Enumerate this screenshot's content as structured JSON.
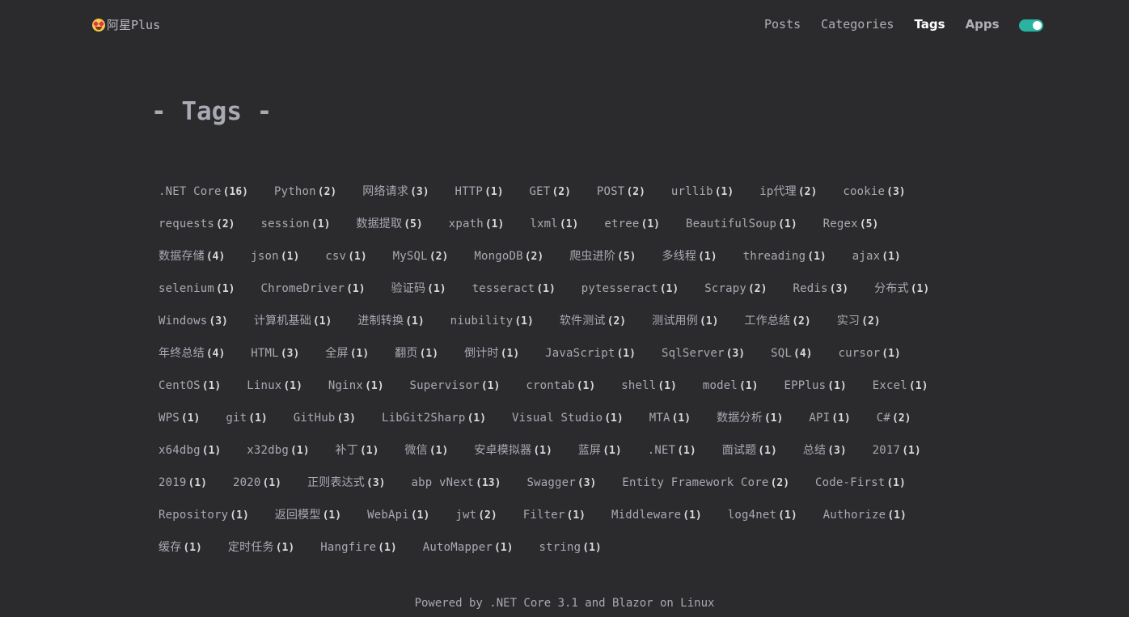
{
  "header": {
    "logo_text": "阿星Plus",
    "nav": [
      {
        "label": "Posts",
        "active": false
      },
      {
        "label": "Categories",
        "active": false
      },
      {
        "label": "Tags",
        "active": true
      },
      {
        "label": "Apps",
        "active": false
      }
    ],
    "theme_toggle_on": true,
    "accent_color": "#2ab3a0"
  },
  "page": {
    "title": "- Tags -"
  },
  "tags": [
    {
      "name": ".NET Core",
      "count": "(16)"
    },
    {
      "name": "Python",
      "count": "(2)"
    },
    {
      "name": "网络请求",
      "count": "(3)"
    },
    {
      "name": "HTTP",
      "count": "(1)"
    },
    {
      "name": "GET",
      "count": "(2)"
    },
    {
      "name": "POST",
      "count": "(2)"
    },
    {
      "name": "urllib",
      "count": "(1)"
    },
    {
      "name": "ip代理",
      "count": "(2)"
    },
    {
      "name": "cookie",
      "count": "(3)"
    },
    {
      "name": "requests",
      "count": "(2)"
    },
    {
      "name": "session",
      "count": "(1)"
    },
    {
      "name": "数据提取",
      "count": "(5)"
    },
    {
      "name": "xpath",
      "count": "(1)"
    },
    {
      "name": "lxml",
      "count": "(1)"
    },
    {
      "name": "etree",
      "count": "(1)"
    },
    {
      "name": "BeautifulSoup",
      "count": "(1)"
    },
    {
      "name": "Regex",
      "count": "(5)"
    },
    {
      "name": "数据存储",
      "count": "(4)"
    },
    {
      "name": "json",
      "count": "(1)"
    },
    {
      "name": "csv",
      "count": "(1)"
    },
    {
      "name": "MySQL",
      "count": "(2)"
    },
    {
      "name": "MongoDB",
      "count": "(2)"
    },
    {
      "name": "爬虫进阶",
      "count": "(5)"
    },
    {
      "name": "多线程",
      "count": "(1)"
    },
    {
      "name": "threading",
      "count": "(1)"
    },
    {
      "name": "ajax",
      "count": "(1)"
    },
    {
      "name": "selenium",
      "count": "(1)"
    },
    {
      "name": "ChromeDriver",
      "count": "(1)"
    },
    {
      "name": "验证码",
      "count": "(1)"
    },
    {
      "name": "tesseract",
      "count": "(1)"
    },
    {
      "name": "pytesseract",
      "count": "(1)"
    },
    {
      "name": "Scrapy",
      "count": "(2)"
    },
    {
      "name": "Redis",
      "count": "(3)"
    },
    {
      "name": "分布式",
      "count": "(1)"
    },
    {
      "name": "Windows",
      "count": "(3)"
    },
    {
      "name": "计算机基础",
      "count": "(1)"
    },
    {
      "name": "进制转换",
      "count": "(1)"
    },
    {
      "name": "niubility",
      "count": "(1)"
    },
    {
      "name": "软件测试",
      "count": "(2)"
    },
    {
      "name": "测试用例",
      "count": "(1)"
    },
    {
      "name": "工作总结",
      "count": "(2)"
    },
    {
      "name": "实习",
      "count": "(2)"
    },
    {
      "name": "年终总结",
      "count": "(4)"
    },
    {
      "name": "HTML",
      "count": "(3)"
    },
    {
      "name": "全屏",
      "count": "(1)"
    },
    {
      "name": "翻页",
      "count": "(1)"
    },
    {
      "name": "倒计时",
      "count": "(1)"
    },
    {
      "name": "JavaScript",
      "count": "(1)"
    },
    {
      "name": "SqlServer",
      "count": "(3)"
    },
    {
      "name": "SQL",
      "count": "(4)"
    },
    {
      "name": "cursor",
      "count": "(1)"
    },
    {
      "name": "CentOS",
      "count": "(1)"
    },
    {
      "name": "Linux",
      "count": "(1)"
    },
    {
      "name": "Nginx",
      "count": "(1)"
    },
    {
      "name": "Supervisor",
      "count": "(1)"
    },
    {
      "name": "crontab",
      "count": "(1)"
    },
    {
      "name": "shell",
      "count": "(1)"
    },
    {
      "name": "model",
      "count": "(1)"
    },
    {
      "name": "EPPlus",
      "count": "(1)"
    },
    {
      "name": "Excel",
      "count": "(1)"
    },
    {
      "name": "WPS",
      "count": "(1)"
    },
    {
      "name": "git",
      "count": "(1)"
    },
    {
      "name": "GitHub",
      "count": "(3)"
    },
    {
      "name": "LibGit2Sharp",
      "count": "(1)"
    },
    {
      "name": "Visual Studio",
      "count": "(1)"
    },
    {
      "name": "MTA",
      "count": "(1)"
    },
    {
      "name": "数据分析",
      "count": "(1)"
    },
    {
      "name": "API",
      "count": "(1)"
    },
    {
      "name": "C#",
      "count": "(2)"
    },
    {
      "name": "x64dbg",
      "count": "(1)"
    },
    {
      "name": "x32dbg",
      "count": "(1)"
    },
    {
      "name": "补丁",
      "count": "(1)"
    },
    {
      "name": "微信",
      "count": "(1)"
    },
    {
      "name": "安卓模拟器",
      "count": "(1)"
    },
    {
      "name": "蓝屏",
      "count": "(1)"
    },
    {
      "name": ".NET",
      "count": "(1)"
    },
    {
      "name": "面试题",
      "count": "(1)"
    },
    {
      "name": "总结",
      "count": "(3)"
    },
    {
      "name": "2017",
      "count": "(1)"
    },
    {
      "name": "2019",
      "count": "(1)"
    },
    {
      "name": "2020",
      "count": "(1)"
    },
    {
      "name": "正则表达式",
      "count": "(3)"
    },
    {
      "name": "abp vNext",
      "count": "(13)"
    },
    {
      "name": "Swagger",
      "count": "(3)"
    },
    {
      "name": "Entity Framework Core",
      "count": "(2)"
    },
    {
      "name": "Code-First",
      "count": "(1)"
    },
    {
      "name": "Repository",
      "count": "(1)"
    },
    {
      "name": "返回模型",
      "count": "(1)"
    },
    {
      "name": "WebApi",
      "count": "(1)"
    },
    {
      "name": "jwt",
      "count": "(2)"
    },
    {
      "name": "Filter",
      "count": "(1)"
    },
    {
      "name": "Middleware",
      "count": "(1)"
    },
    {
      "name": "log4net",
      "count": "(1)"
    },
    {
      "name": "Authorize",
      "count": "(1)"
    },
    {
      "name": "缓存",
      "count": "(1)"
    },
    {
      "name": "定时任务",
      "count": "(1)"
    },
    {
      "name": "Hangfire",
      "count": "(1)"
    },
    {
      "name": "AutoMapper",
      "count": "(1)"
    },
    {
      "name": "string",
      "count": "(1)"
    }
  ],
  "footer": {
    "text": "Powered by .NET Core 3.1 and Blazor on Linux"
  }
}
